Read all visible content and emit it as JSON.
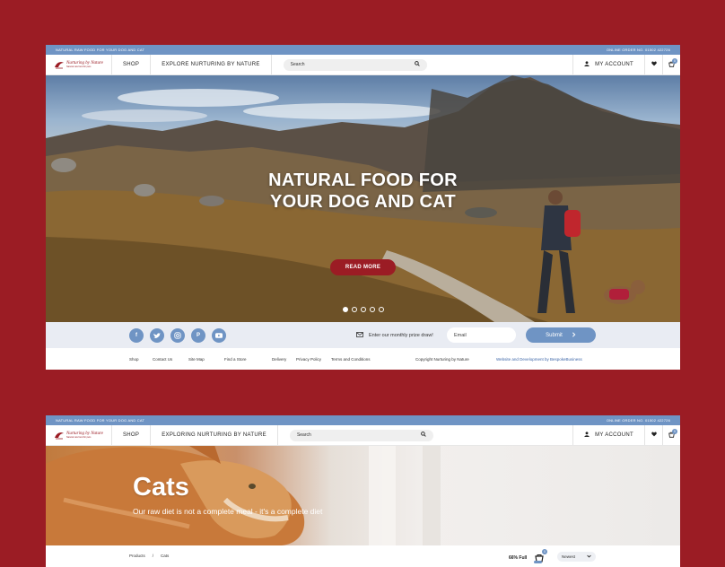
{
  "page1": {
    "topbar": {
      "left": "NATURAL RAW FOOD FOR YOUR DOG AND CAT",
      "right": "ONLINE ORDER NO. 01502 422726"
    },
    "logo": {
      "name": "Nurturing by Nature",
      "sub": "Natural raw food for pets"
    },
    "nav": {
      "shop": "SHOP",
      "explore": "EXPLORE NURTURING BY NATURE",
      "search_placeholder": "Search",
      "account": "MY ACCOUNT",
      "cart_count": "0"
    },
    "hero": {
      "title_line1": "NATURAL FOOD FOR",
      "title_line2": "YOUR DOG AND CAT",
      "button": "READ MORE",
      "slide_count": 5,
      "active_slide": 1
    },
    "subbar": {
      "socials": [
        "facebook-icon",
        "twitter-icon",
        "instagram-icon",
        "pinterest-icon",
        "youtube-icon"
      ],
      "prize_text": "Enter our monthly prize draw!",
      "email_placeholder": "Email",
      "submit": "Submit"
    },
    "footer": {
      "links": [
        "Shop",
        "Contact Us",
        "Site Map",
        "Find a Store",
        "Delivery",
        "Privacy Policy",
        "Terms and Conditions"
      ],
      "copyright": "Copyright Nurturing by Nature",
      "dev": "Website and Development by BespokeBusiness"
    }
  },
  "page2": {
    "topbar": {
      "left": "NATURAL RAW FOOD FOR YOUR DOG AND CAT",
      "right": "ONLINE ORDER NO. 01502 422726"
    },
    "logo": {
      "name": "Nurturing by Nature",
      "sub": "Natural raw food for pets"
    },
    "nav": {
      "shop": "SHOP",
      "explore": "EXPLORING NURTURING BY NATURE",
      "search_placeholder": "Search",
      "account": "MY ACCOUNT",
      "cart_count": "0"
    },
    "hero": {
      "title": "Cats",
      "subtitle": "Our raw diet is not a complete meal - it's a complete diet"
    },
    "breadcrumb": {
      "first": "Products",
      "sep": "/",
      "current": "Cats"
    },
    "fullness": "66% Full",
    "mini_cart_count": "0",
    "sort": "Newest"
  },
  "colors": {
    "brand_red": "#9b1c24",
    "accent_blue": "#6f94c4"
  }
}
